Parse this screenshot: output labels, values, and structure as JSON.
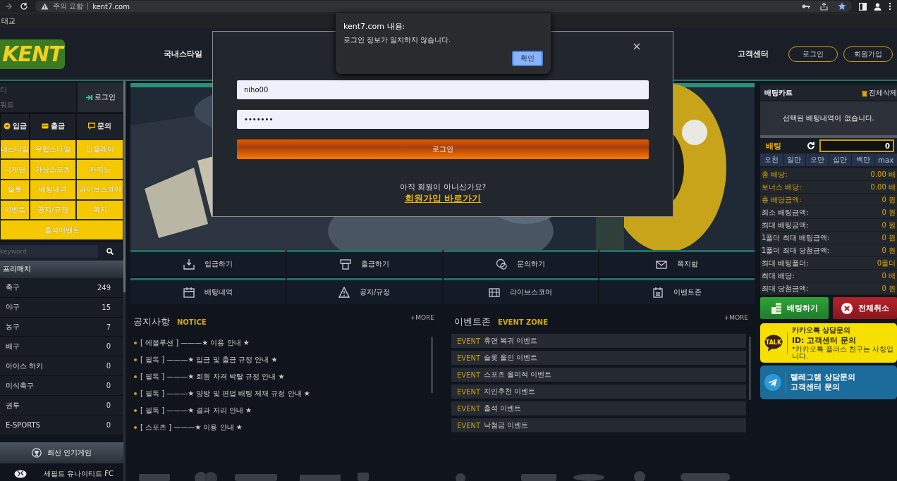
{
  "browser": {
    "security_label": "주의 요함",
    "url": "kent7.com",
    "bookmark": "태교"
  },
  "header": {
    "logo": "KENT",
    "nav": [
      "국내스타일",
      "고객센터"
    ],
    "buttons": [
      "로그인",
      "회원가입"
    ]
  },
  "sidebar": {
    "login": {
      "id_placeholder": "디",
      "pw_placeholder": "워드",
      "button": "로그인"
    },
    "tabs": [
      "입금",
      "출금",
      "문의"
    ],
    "menu": [
      "내스타일",
      "유럽스타일",
      "인플레이",
      "니게임",
      "가상스포츠",
      "카지노",
      "슬롯",
      "배팅내역",
      "라이브스코어",
      "이벤트",
      "공지/규정",
      "쪽지"
    ],
    "menu_wide": "출석이벤트",
    "search": {
      "placeholder": "keyword"
    },
    "section": "프리매치",
    "sports": [
      {
        "name": "축구",
        "count": "249"
      },
      {
        "name": "야구",
        "count": "15"
      },
      {
        "name": "농구",
        "count": "7"
      },
      {
        "name": "배구",
        "count": "0"
      },
      {
        "name": "아이스 하키",
        "count": "0"
      },
      {
        "name": "미식축구",
        "count": "0"
      },
      {
        "name": "권투",
        "count": "0"
      },
      {
        "name": "E-SPORTS",
        "count": "0"
      }
    ],
    "popular_button": "최신 인기게임",
    "game_team": "세필드 유나이티드 FC"
  },
  "quick_links": [
    "입금하기",
    "출금하기",
    "문의하기",
    "쪽지함",
    "배팅내역",
    "공지/규정",
    "라이브스코어",
    "이벤트존"
  ],
  "notice": {
    "title": "공지사항",
    "subtitle": "NOTICE",
    "more": "+MORE",
    "items": [
      "[ 에볼루션 ] ———★ 이용 안내 ★",
      "[ 필독 ] ———★ 입금 및 출금 규정 안내 ★",
      "[ 필독 ] ———★ 회원 자격 박탈 규정 안내 ★",
      "[ 필독 ] ———★ 양방 및 편법 배팅 제재 규정 안내 ★",
      "[ 필독 ] ———★ 결과 처리 안내 ★",
      "[ 스포츠 ] ———★ 이용 안내 ★"
    ]
  },
  "events": {
    "title": "이벤트존",
    "subtitle": "EVENT ZONE",
    "more": "+MORE",
    "items": [
      {
        "tag": "EVENT",
        "text": "휴면 복귀 이벤트"
      },
      {
        "tag": "EVENT",
        "text": "슬롯 올인 이벤트"
      },
      {
        "tag": "EVENT",
        "text": "스포츠 올미적 이벤트"
      },
      {
        "tag": "EVENT",
        "text": "지인추천 이벤트"
      },
      {
        "tag": "EVENT",
        "text": "출석 이벤트"
      },
      {
        "tag": "EVENT",
        "text": "낙첨금 이벤트"
      }
    ]
  },
  "bet_slip": {
    "title": "배팅카트",
    "clear_all": "전체삭제",
    "empty_message": "선택된 배팅내역이 없습니다.",
    "bet_label": "배팅",
    "amount": "0",
    "chips": [
      "오천",
      "일만",
      "오만",
      "십만",
      "백만",
      "max"
    ],
    "rows": [
      {
        "label": "총 배당:",
        "value": "0.00 배",
        "highlighted": true
      },
      {
        "label": "보너스 배당:",
        "value": "0.00 배",
        "highlighted": true
      },
      {
        "label": "총 배당금액:",
        "value": "0 원",
        "highlighted": true
      },
      {
        "label": "최소 배팅금액:",
        "value": "0 원",
        "highlighted": false
      },
      {
        "label": "최대 배팅금액:",
        "value": "0 원",
        "highlighted": false
      },
      {
        "label": "1폴더 최대 배팅금액:",
        "value": "0 원",
        "highlighted": false
      },
      {
        "label": "1폴더 최대 당첨금액:",
        "value": "0 원",
        "highlighted": false
      },
      {
        "label": "최대 배팅폴더:",
        "value": "0폴더",
        "highlighted": false
      },
      {
        "label": "최대 배당:",
        "value": "0 배",
        "highlighted": false
      },
      {
        "label": "최대 당첨금액:",
        "value": "0 원",
        "highlighted": false
      }
    ],
    "place_button": "배팅하기",
    "cancel_button": "전체취소"
  },
  "kakao": {
    "icon_text": "TALK",
    "line1": "카카오톡 상담문의",
    "line2": "ID: 고객센터 문의",
    "note": "*카카오톡 플러스 친구는 사칭입니다."
  },
  "telegram": {
    "line1": "텔레그램 상담문의",
    "line2": "고객센터 문의"
  },
  "login_modal": {
    "username": "niho00",
    "password": "•••••••",
    "login_button": "로그인",
    "signup_prompt": "아직 회원이 아니신가요?",
    "signup_link": "회원가입 바로가기"
  },
  "alert": {
    "title": "kent7.com 내용:",
    "message": "로그인 정보가 일치하지 않습니다.",
    "button": "확인"
  }
}
